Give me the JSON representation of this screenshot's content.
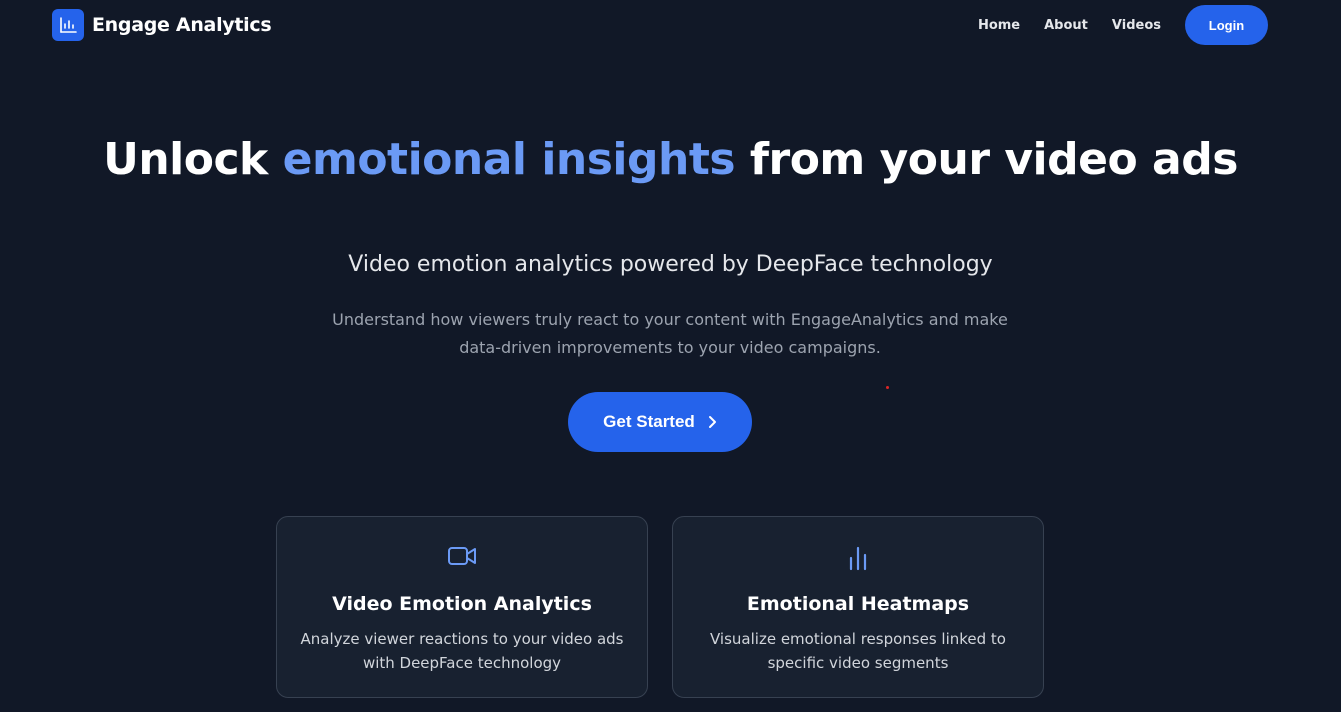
{
  "header": {
    "brand_name": "Engage Analytics",
    "brand_icon": "bar-chart-icon",
    "nav": [
      "Home",
      "About",
      "Videos"
    ],
    "login_label": "Login"
  },
  "hero": {
    "title_part1": "Unlock ",
    "title_accent": "emotional insights",
    "title_part2": " from your video ads",
    "subtitle": "Video emotion analytics powered by DeepFace technology",
    "description": "Understand how viewers truly react to your content with EngageAnalytics and make data-driven improvements to your video campaigns.",
    "cta_label": "Get Started",
    "cta_icon": "chevron-right-icon"
  },
  "features": [
    {
      "icon": "video-camera-icon",
      "title": "Video Emotion Analytics",
      "description": "Analyze viewer reactions to your video ads with DeepFace technology"
    },
    {
      "icon": "bar-chart-icon",
      "title": "Emotional Heatmaps",
      "description": "Visualize emotional responses linked to specific video segments"
    }
  ],
  "colors": {
    "background": "#111827",
    "accent": "#2563eb",
    "accent_text": "#6b9af5",
    "card_background": "#182130",
    "card_border": "#374151"
  }
}
